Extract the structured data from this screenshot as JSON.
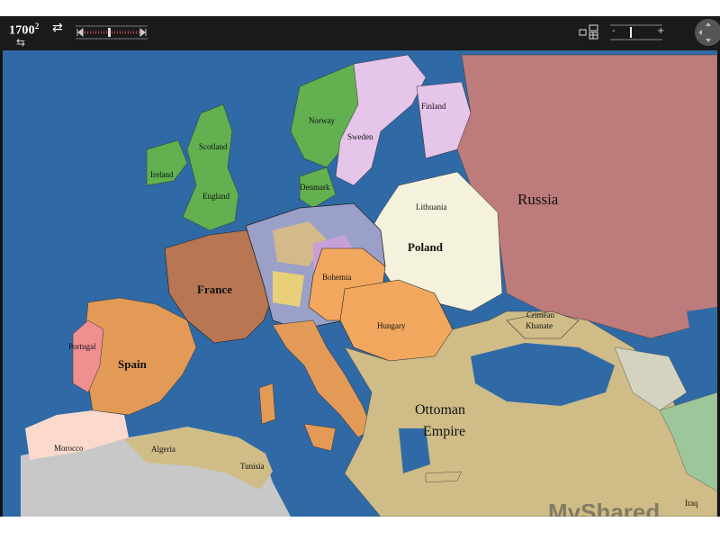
{
  "toolbar": {
    "year": "1700",
    "year_suffix": "2"
  },
  "zoom": {
    "minus": "-",
    "plus": "+"
  },
  "colors": {
    "sea": "#2f6aa6",
    "russia": "#be7b7b",
    "ottoman": "#cfbc87",
    "france": "#b87653",
    "spain": "#e39a57",
    "habsburg": "#f2a75e",
    "poland": "#f4f2dc",
    "sweden": "#e6c5ea",
    "england": "#62b04f",
    "portugal": "#ef8f8f",
    "morocco": "#fbd9cc"
  },
  "map": {
    "labels": {
      "norway": "Norway",
      "sweden": "Sweden",
      "finland": "Finland",
      "scotland": "Scotland",
      "ireland": "Ireland",
      "england": "England",
      "denmark": "Denmark",
      "lithuania": "Lithuania",
      "russia": "Russia",
      "poland": "Poland",
      "france": "France",
      "bohemia": "Bohemia",
      "portugal": "Portugal",
      "spain": "Spain",
      "hungary": "Hungary",
      "crimean": "Crimean",
      "khanate": "Khanate",
      "ottoman1": "Ottoman",
      "ottoman2": "Empire",
      "morocco": "Morocco",
      "algeria": "Algeria",
      "tunisia": "Tunisia",
      "iraq": "Iraq"
    }
  },
  "watermark": "MyShared"
}
